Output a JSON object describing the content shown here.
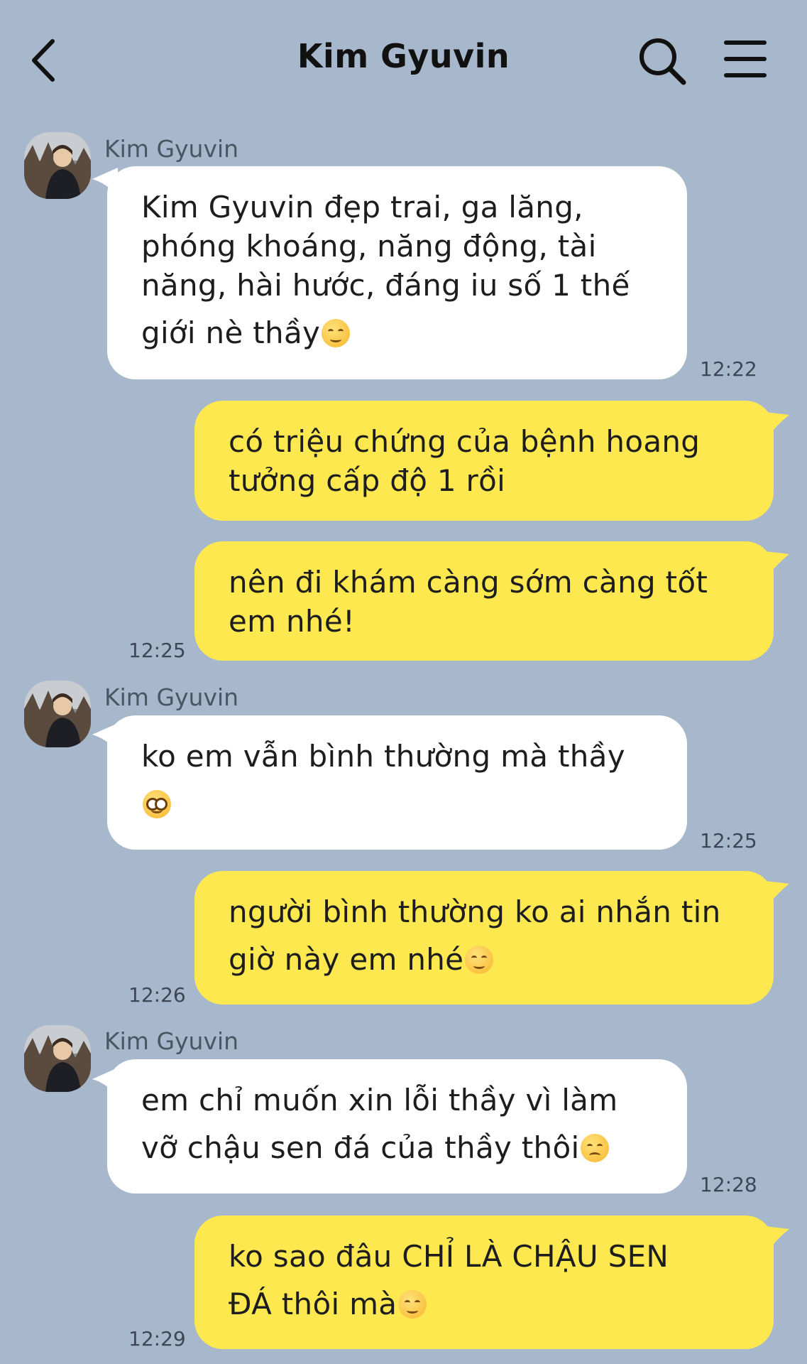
{
  "header": {
    "title": "Kim Gyuvin",
    "back_icon": "chevron-left-icon",
    "search_icon": "search-icon",
    "menu_icon": "hamburger-menu-icon"
  },
  "colors": {
    "background": "#a8b8cc",
    "incoming_bubble": "#ffffff",
    "outgoing_bubble": "#fde84f"
  },
  "messages": [
    {
      "direction": "incoming",
      "sender": "Kim Gyuvin",
      "lines": [
        "Kim Gyuvin đẹp trai, ga lăng,",
        "phóng khoáng, năng động, tài",
        "năng, hài hước, đáng iu số 1 thế",
        "giới nè thầy"
      ],
      "emoji": "smiling-face",
      "time": "12:22"
    },
    {
      "direction": "outgoing",
      "lines": [
        "có triệu chứng của bệnh hoang",
        "tưởng cấp độ 1 rồi"
      ],
      "time": ""
    },
    {
      "direction": "outgoing",
      "lines": [
        "nên đi khám càng sớm càng tốt",
        "em nhé!"
      ],
      "time": "12:25"
    },
    {
      "direction": "incoming",
      "sender": "Kim Gyuvin",
      "lines": [
        "ko em vẫn bình thường mà thầy",
        ""
      ],
      "emoji": "pleading-face",
      "time": "12:25"
    },
    {
      "direction": "outgoing",
      "lines": [
        "người bình thường ko ai nhắn tin",
        "giờ này em nhé"
      ],
      "emoji": "smiling-face",
      "time": "12:26"
    },
    {
      "direction": "incoming",
      "sender": "Kim Gyuvin",
      "lines": [
        "em chỉ muốn xin lỗi thầy vì làm",
        "vỡ chậu sen đá của thầy thôi"
      ],
      "emoji": "disappointed-face",
      "time": "12:28"
    },
    {
      "direction": "outgoing",
      "lines": [
        "ko sao đâu CHỈ LÀ CHẬU SEN",
        "ĐÁ thôi mà"
      ],
      "emoji": "relieved-face",
      "time": "12:29"
    }
  ]
}
